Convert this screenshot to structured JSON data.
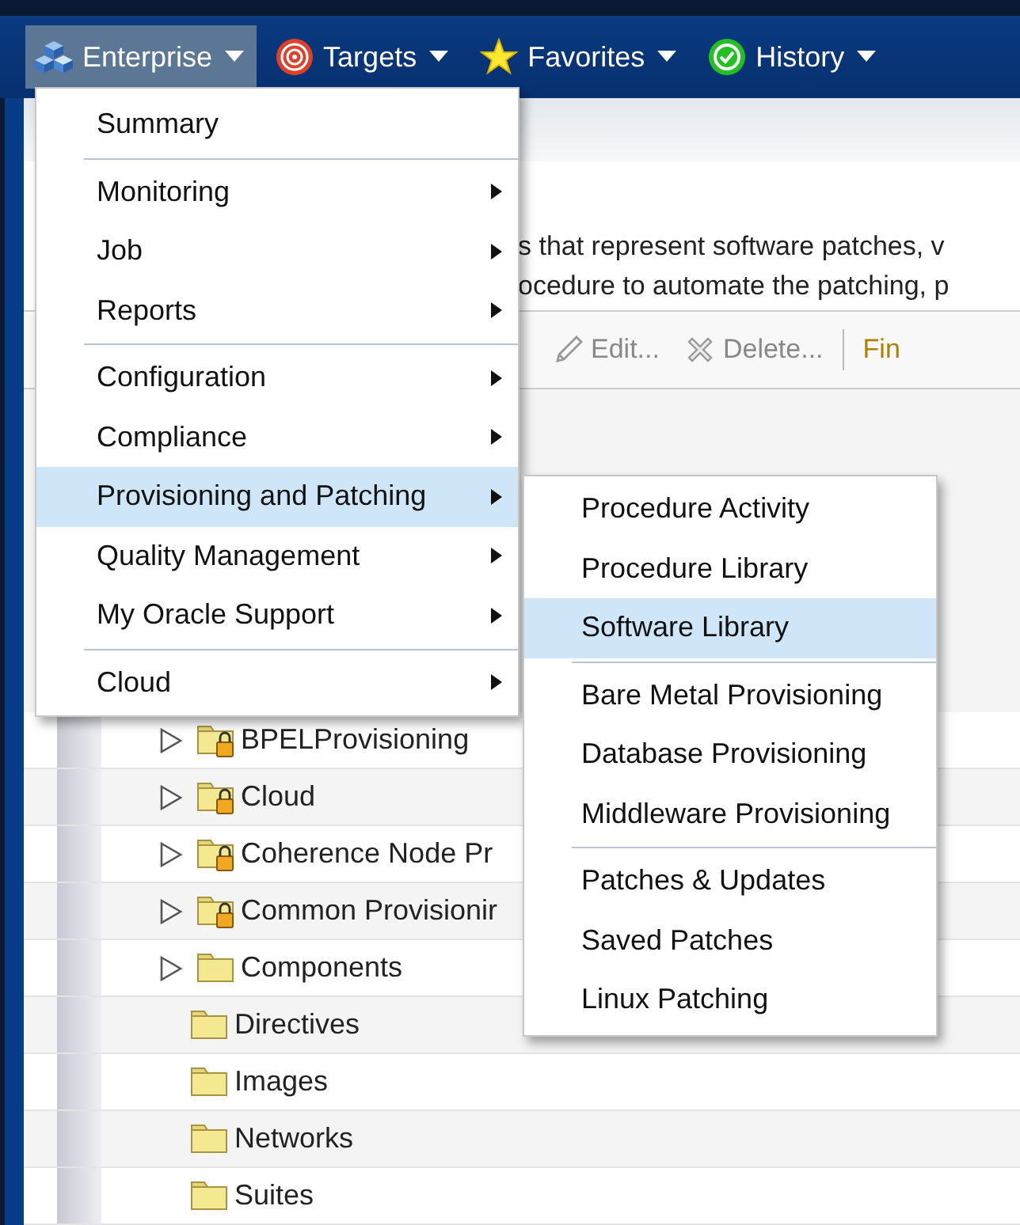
{
  "nav": [
    {
      "label": "Enterprise",
      "selected": true
    },
    {
      "label": "Targets",
      "selected": false
    },
    {
      "label": "Favorites",
      "selected": false
    },
    {
      "label": "History",
      "selected": false
    }
  ],
  "description": [
    "s that represent software patches, v",
    "ocedure to automate the patching, p"
  ],
  "toolbar": [
    "Edit...",
    "Delete...",
    "Fin"
  ],
  "tree": [
    {
      "label": "BPELProvisioning",
      "locked": true,
      "expandable": true
    },
    {
      "label": "Cloud",
      "locked": true,
      "expandable": true
    },
    {
      "label": "Coherence Node Pr",
      "locked": true,
      "expandable": true
    },
    {
      "label": "Common Provisionir",
      "locked": true,
      "expandable": true
    },
    {
      "label": "Components",
      "locked": false,
      "expandable": true
    },
    {
      "label": "Directives",
      "locked": false,
      "expandable": false
    },
    {
      "label": "Images",
      "locked": false,
      "expandable": false
    },
    {
      "label": "Networks",
      "locked": false,
      "expandable": false
    },
    {
      "label": "Suites",
      "locked": false,
      "expandable": false
    }
  ],
  "menu": [
    [
      {
        "label": "Summary",
        "submenu": false,
        "selected": false
      }
    ],
    [
      {
        "label": "Monitoring",
        "submenu": true,
        "selected": false
      },
      {
        "label": "Job",
        "submenu": true,
        "selected": false
      },
      {
        "label": "Reports",
        "submenu": true,
        "selected": false
      }
    ],
    [
      {
        "label": "Configuration",
        "submenu": true,
        "selected": false
      },
      {
        "label": "Compliance",
        "submenu": true,
        "selected": false
      },
      {
        "label": "Provisioning and Patching",
        "submenu": true,
        "selected": true
      },
      {
        "label": "Quality Management",
        "submenu": true,
        "selected": false
      },
      {
        "label": "My Oracle Support",
        "submenu": true,
        "selected": false
      }
    ],
    [
      {
        "label": "Cloud",
        "submenu": true,
        "selected": false
      }
    ]
  ],
  "submenu": [
    [
      {
        "label": "Procedure Activity",
        "selected": false
      },
      {
        "label": "Procedure Library",
        "selected": false
      },
      {
        "label": "Software Library",
        "selected": true
      }
    ],
    [
      {
        "label": "Bare Metal Provisioning",
        "selected": false
      },
      {
        "label": "Database Provisioning",
        "selected": false
      },
      {
        "label": "Middleware Provisioning",
        "selected": false
      }
    ],
    [
      {
        "label": "Patches & Updates",
        "selected": false
      },
      {
        "label": "Saved Patches",
        "selected": false
      },
      {
        "label": "Linux Patching",
        "selected": false
      }
    ]
  ]
}
